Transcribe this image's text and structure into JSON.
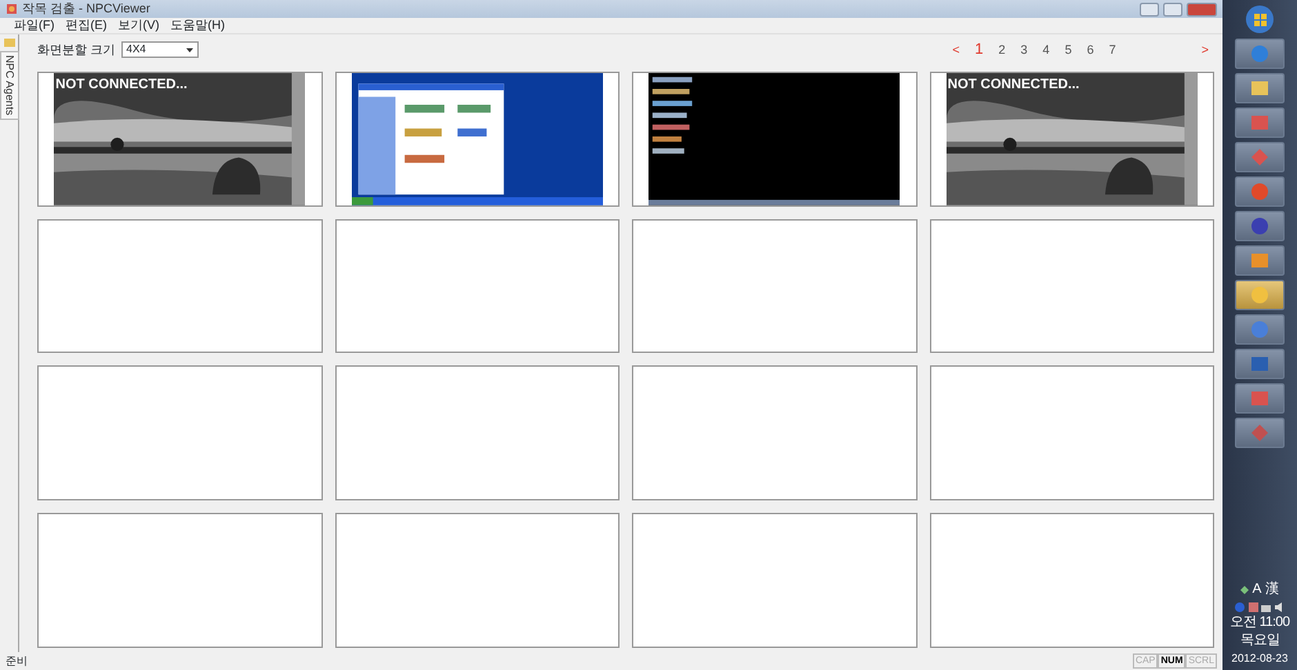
{
  "window": {
    "title": "작목 검출 - NPCViewer"
  },
  "menu": [
    "파일(F)",
    "편집(E)",
    "보기(V)",
    "도움말(H)"
  ],
  "side_tab": {
    "label": "NPC Agents"
  },
  "split_size": {
    "label": "화면분할 크기",
    "value": "4X4"
  },
  "pagination": {
    "prev": "<",
    "next": ">",
    "pages": [
      {
        "label": "1",
        "selected": true
      },
      {
        "label": "2",
        "selected": false
      },
      {
        "label": "3",
        "selected": false
      },
      {
        "label": "4",
        "selected": false
      },
      {
        "label": "5",
        "selected": false
      },
      {
        "label": "6",
        "selected": false
      },
      {
        "label": "7",
        "selected": false
      }
    ]
  },
  "tiles": [
    {
      "kind": "picture",
      "overlay": "NOT CONNECTED..."
    },
    {
      "kind": "picture"
    },
    {
      "kind": "picture"
    },
    {
      "kind": "picture",
      "overlay": "NOT CONNECTED..."
    },
    {
      "kind": "empty"
    },
    {
      "kind": "empty"
    },
    {
      "kind": "empty"
    },
    {
      "kind": "empty"
    },
    {
      "kind": "empty"
    },
    {
      "kind": "empty"
    },
    {
      "kind": "empty"
    },
    {
      "kind": "empty"
    },
    {
      "kind": "empty"
    },
    {
      "kind": "empty"
    },
    {
      "kind": "empty"
    },
    {
      "kind": "empty"
    }
  ],
  "status_bar": {
    "text": "준비",
    "indicators": [
      {
        "label": "CAP",
        "on": false
      },
      {
        "label": "NUM",
        "on": true
      },
      {
        "label": "SCRL",
        "on": false
      }
    ]
  },
  "taskbar": {
    "tray_text": [
      "A",
      "漢"
    ],
    "clock": {
      "time": "오전 11:00",
      "day": "목요일",
      "date": "2012-08-23"
    }
  }
}
